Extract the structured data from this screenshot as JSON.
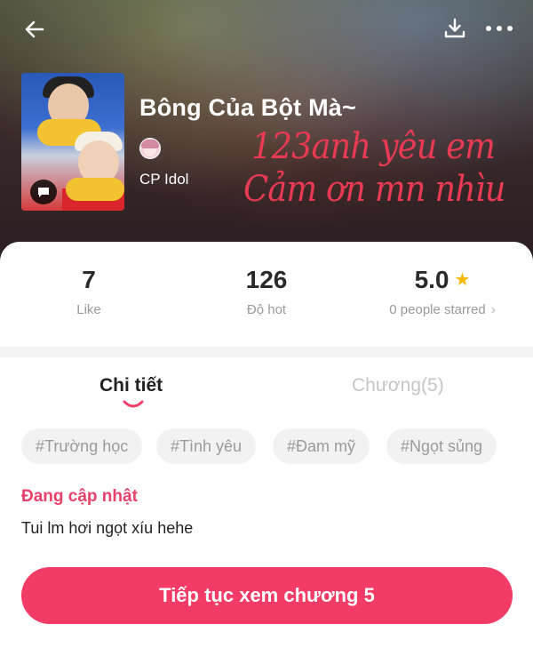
{
  "header": {
    "back_icon": "arrow-left-icon",
    "download_icon": "download-icon",
    "more_icon": "more-dots-icon"
  },
  "story": {
    "title": "Bông Của Bột Mà~",
    "author": "CP Idol",
    "handwriting_line1": "123anh yêu em",
    "handwriting_line2": "Cảm ơn mn nhìu"
  },
  "stats": {
    "like_value": "7",
    "like_label": "Like",
    "hot_value": "126",
    "hot_label": "Độ hot",
    "rating_value": "5.0",
    "rating_label": "0 people starred"
  },
  "tabs": {
    "detail": "Chi tiết",
    "chapters": "Chương(5)"
  },
  "tags": [
    "#Trường học",
    "#Tình yêu",
    "#Đam mỹ",
    "#Ngọt sủng"
  ],
  "status": "Đang cập nhật",
  "description": "Tui lm hơi ngọt xíu hehe",
  "cta_label": "Tiếp tục xem chương 5",
  "colors": {
    "accent": "#f23b66",
    "status": "#e8416b",
    "handwriting": "#e83a52",
    "star": "#f5b800"
  }
}
